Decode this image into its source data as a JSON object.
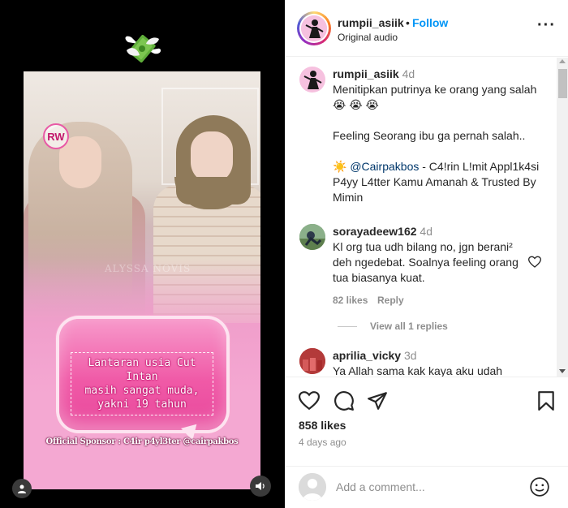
{
  "media": {
    "logo_text": "RW",
    "watermark": "ALYSSA NOVIS",
    "caption_lines": [
      "Lantaran usia Cut Intan",
      "masih sangat muda,",
      "yakni 19 tahun"
    ],
    "sponsor": "Official Sponsor : C4ir p4yl3ter @cairpakbos"
  },
  "header": {
    "username": "rumpii_asiik",
    "dot": "•",
    "follow_label": "Follow",
    "audio": "Original audio",
    "more_label": "···"
  },
  "caption_post": {
    "username": "rumpii_asiik",
    "time": "4d",
    "line1": "Menitipkan putrinya ke orang yang salah 😭 😭 😭",
    "line2": "Feeling Seorang ibu ga pernah salah..",
    "sponsor_emoji": "☀️",
    "mention": "@Cairpakbos",
    "sponsor_text": " - C4!rin L!mit Appl1k4si P4yy L4tter Kamu Amanah & Trusted By Mimin"
  },
  "comments": [
    {
      "username": "sorayadeew162",
      "time": "4d",
      "text": "Kl org tua udh bilang no, jgn berani² deh ngedebat. Soalnya feeling orang tua biasanya kuat.",
      "likes": "82 likes",
      "reply_label": "Reply",
      "view_replies": "View all 1 replies"
    },
    {
      "username": "aprilia_vicky",
      "time": "3d",
      "text": "Ya Allah sama kak kaya aku udah"
    }
  ],
  "actions": {
    "likes": "858 likes",
    "posted": "4 days ago"
  },
  "add_comment": {
    "placeholder": "Add a comment..."
  },
  "colors": {
    "accent": "#0095f6",
    "pink": "#f05aa7"
  }
}
